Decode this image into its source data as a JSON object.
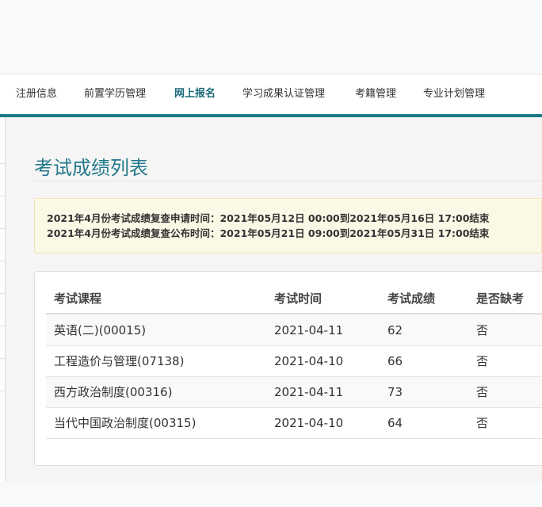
{
  "nav": {
    "items": [
      {
        "label": "注册信息"
      },
      {
        "label": "前置学历管理"
      },
      {
        "label": "网上报名",
        "active": true
      },
      {
        "label": "学习成果认证管理"
      },
      {
        "label": "考籍管理"
      },
      {
        "label": "专业计划管理"
      }
    ]
  },
  "page": {
    "title": "考试成绩列表"
  },
  "notice": {
    "line1": "2021年4月份考试成绩复查申请时间：2021年05月12日 00:00到2021年05月16日 17:00结束",
    "line2": "2021年4月份考试成绩复查公布时间：2021年05月21日 09:00到2021年05月31日 17:00结束"
  },
  "table": {
    "headers": [
      "考试课程",
      "考试时间",
      "考试成绩",
      "是否缺考"
    ],
    "rows": [
      [
        "英语(二)(00015)",
        "2021-04-11",
        "62",
        "否"
      ],
      [
        "工程造价与管理(07138)",
        "2021-04-10",
        "66",
        "否"
      ],
      [
        "西方政治制度(00316)",
        "2021-04-11",
        "73",
        "否"
      ],
      [
        "当代中国政治制度(00315)",
        "2021-04-10",
        "64",
        "否"
      ]
    ]
  },
  "colors": {
    "accent": "#1a7a86",
    "title": "#23798c",
    "notice_bg": "#fcf8e6"
  }
}
